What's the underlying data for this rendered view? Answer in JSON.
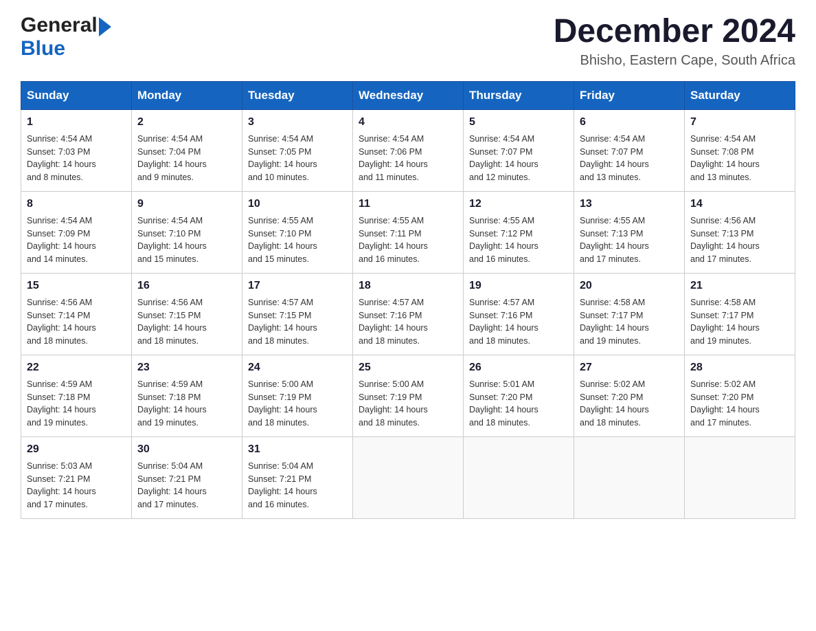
{
  "header": {
    "logo_general": "General",
    "logo_blue": "Blue",
    "month_title": "December 2024",
    "location": "Bhisho, Eastern Cape, South Africa"
  },
  "days_of_week": [
    "Sunday",
    "Monday",
    "Tuesday",
    "Wednesday",
    "Thursday",
    "Friday",
    "Saturday"
  ],
  "weeks": [
    [
      {
        "day": "1",
        "sunrise": "4:54 AM",
        "sunset": "7:03 PM",
        "daylight": "14 hours and 8 minutes."
      },
      {
        "day": "2",
        "sunrise": "4:54 AM",
        "sunset": "7:04 PM",
        "daylight": "14 hours and 9 minutes."
      },
      {
        "day": "3",
        "sunrise": "4:54 AM",
        "sunset": "7:05 PM",
        "daylight": "14 hours and 10 minutes."
      },
      {
        "day": "4",
        "sunrise": "4:54 AM",
        "sunset": "7:06 PM",
        "daylight": "14 hours and 11 minutes."
      },
      {
        "day": "5",
        "sunrise": "4:54 AM",
        "sunset": "7:07 PM",
        "daylight": "14 hours and 12 minutes."
      },
      {
        "day": "6",
        "sunrise": "4:54 AM",
        "sunset": "7:07 PM",
        "daylight": "14 hours and 13 minutes."
      },
      {
        "day": "7",
        "sunrise": "4:54 AM",
        "sunset": "7:08 PM",
        "daylight": "14 hours and 13 minutes."
      }
    ],
    [
      {
        "day": "8",
        "sunrise": "4:54 AM",
        "sunset": "7:09 PM",
        "daylight": "14 hours and 14 minutes."
      },
      {
        "day": "9",
        "sunrise": "4:54 AM",
        "sunset": "7:10 PM",
        "daylight": "14 hours and 15 minutes."
      },
      {
        "day": "10",
        "sunrise": "4:55 AM",
        "sunset": "7:10 PM",
        "daylight": "14 hours and 15 minutes."
      },
      {
        "day": "11",
        "sunrise": "4:55 AM",
        "sunset": "7:11 PM",
        "daylight": "14 hours and 16 minutes."
      },
      {
        "day": "12",
        "sunrise": "4:55 AM",
        "sunset": "7:12 PM",
        "daylight": "14 hours and 16 minutes."
      },
      {
        "day": "13",
        "sunrise": "4:55 AM",
        "sunset": "7:13 PM",
        "daylight": "14 hours and 17 minutes."
      },
      {
        "day": "14",
        "sunrise": "4:56 AM",
        "sunset": "7:13 PM",
        "daylight": "14 hours and 17 minutes."
      }
    ],
    [
      {
        "day": "15",
        "sunrise": "4:56 AM",
        "sunset": "7:14 PM",
        "daylight": "14 hours and 18 minutes."
      },
      {
        "day": "16",
        "sunrise": "4:56 AM",
        "sunset": "7:15 PM",
        "daylight": "14 hours and 18 minutes."
      },
      {
        "day": "17",
        "sunrise": "4:57 AM",
        "sunset": "7:15 PM",
        "daylight": "14 hours and 18 minutes."
      },
      {
        "day": "18",
        "sunrise": "4:57 AM",
        "sunset": "7:16 PM",
        "daylight": "14 hours and 18 minutes."
      },
      {
        "day": "19",
        "sunrise": "4:57 AM",
        "sunset": "7:16 PM",
        "daylight": "14 hours and 18 minutes."
      },
      {
        "day": "20",
        "sunrise": "4:58 AM",
        "sunset": "7:17 PM",
        "daylight": "14 hours and 19 minutes."
      },
      {
        "day": "21",
        "sunrise": "4:58 AM",
        "sunset": "7:17 PM",
        "daylight": "14 hours and 19 minutes."
      }
    ],
    [
      {
        "day": "22",
        "sunrise": "4:59 AM",
        "sunset": "7:18 PM",
        "daylight": "14 hours and 19 minutes."
      },
      {
        "day": "23",
        "sunrise": "4:59 AM",
        "sunset": "7:18 PM",
        "daylight": "14 hours and 19 minutes."
      },
      {
        "day": "24",
        "sunrise": "5:00 AM",
        "sunset": "7:19 PM",
        "daylight": "14 hours and 18 minutes."
      },
      {
        "day": "25",
        "sunrise": "5:00 AM",
        "sunset": "7:19 PM",
        "daylight": "14 hours and 18 minutes."
      },
      {
        "day": "26",
        "sunrise": "5:01 AM",
        "sunset": "7:20 PM",
        "daylight": "14 hours and 18 minutes."
      },
      {
        "day": "27",
        "sunrise": "5:02 AM",
        "sunset": "7:20 PM",
        "daylight": "14 hours and 18 minutes."
      },
      {
        "day": "28",
        "sunrise": "5:02 AM",
        "sunset": "7:20 PM",
        "daylight": "14 hours and 17 minutes."
      }
    ],
    [
      {
        "day": "29",
        "sunrise": "5:03 AM",
        "sunset": "7:21 PM",
        "daylight": "14 hours and 17 minutes."
      },
      {
        "day": "30",
        "sunrise": "5:04 AM",
        "sunset": "7:21 PM",
        "daylight": "14 hours and 17 minutes."
      },
      {
        "day": "31",
        "sunrise": "5:04 AM",
        "sunset": "7:21 PM",
        "daylight": "14 hours and 16 minutes."
      },
      null,
      null,
      null,
      null
    ]
  ],
  "labels": {
    "sunrise": "Sunrise:",
    "sunset": "Sunset:",
    "daylight": "Daylight:"
  }
}
